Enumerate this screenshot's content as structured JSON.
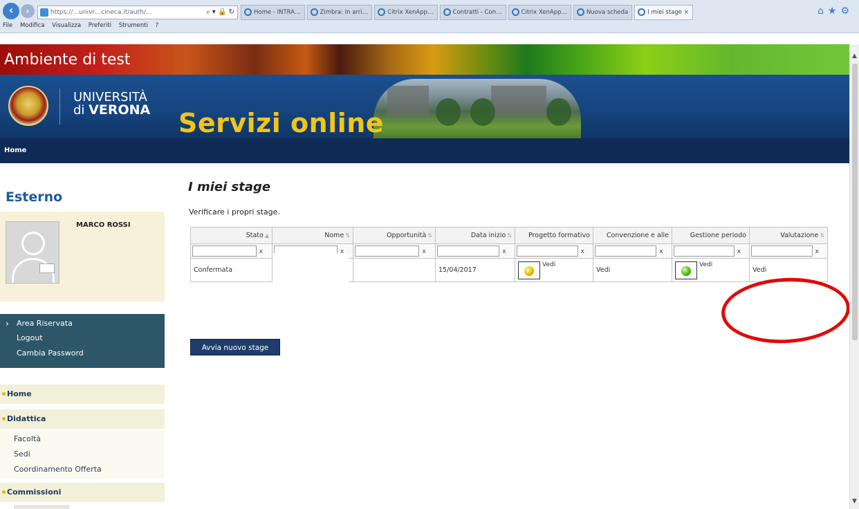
{
  "browser": {
    "url": "https://…univr…cineca.it/auth/…",
    "tabs": [
      "Home - INTRA…",
      "Zimbra: In arri…",
      "Citrix XenApp…",
      "Contratti - Con…",
      "Citrix XenApp…",
      "Nuova scheda",
      "I miei stage"
    ],
    "menu": [
      "File",
      "Modifica",
      "Visualizza",
      "Preferiti",
      "Strumenti",
      "?"
    ]
  },
  "banner": {
    "title": "Ambiente di test"
  },
  "header": {
    "uni_line1": "UNIVERSITÀ",
    "uni_line2_prefix": "di ",
    "uni_line2": "VERONA",
    "servizi": "Servizi online"
  },
  "navbar": {
    "home": "Home"
  },
  "sidebar": {
    "role": "Esterno",
    "user": "MARCO ROSSI",
    "area": {
      "title": "Area Riservata",
      "items": [
        "Logout",
        "Cambia Password"
      ]
    },
    "sections": [
      "Home",
      "Didattica",
      "Commissioni"
    ],
    "didattica_items": [
      "Facoltà",
      "Sedi",
      "Coordinamento Offerta"
    ]
  },
  "main": {
    "title": "I miei stage",
    "subtitle": "Verificare i propri stage.",
    "columns": [
      "Stato",
      "Nome",
      "Opportunità",
      "Data inizio",
      "Progetto formativo",
      "Convenzione e alle",
      "Gestione periodo",
      "Valutazione"
    ],
    "filter_clear": "x",
    "row": {
      "stato": "Confermata",
      "nome": "",
      "opportunita": "",
      "data_inizio": "15/04/2017",
      "progetto": "Vedi",
      "convenzione": "Vedi",
      "gestione": "Vedi",
      "valutazione": "Vedi"
    },
    "button": "Avvia nuovo stage"
  },
  "colors": {
    "navbar": "#0f2a54",
    "header": "#16447e",
    "servizi": "#f1c51a",
    "annotation": "#e10a0a"
  }
}
